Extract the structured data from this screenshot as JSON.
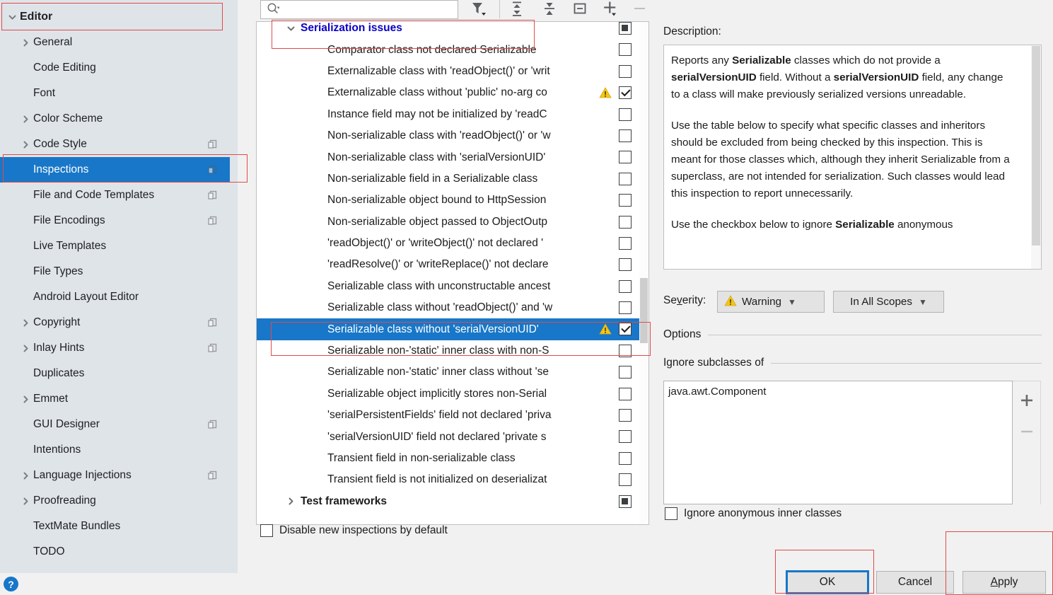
{
  "sidebar": {
    "root": {
      "label": "Editor",
      "expanded": true
    },
    "items": [
      {
        "label": "General",
        "arrow": "collapsed",
        "badge": false
      },
      {
        "label": "Code Editing",
        "arrow": "none",
        "badge": false
      },
      {
        "label": "Font",
        "arrow": "none",
        "badge": false
      },
      {
        "label": "Color Scheme",
        "arrow": "collapsed",
        "badge": false
      },
      {
        "label": "Code Style",
        "arrow": "collapsed",
        "badge": true
      },
      {
        "label": "Inspections",
        "arrow": "none",
        "badge": true,
        "selected": true
      },
      {
        "label": "File and Code Templates",
        "arrow": "none",
        "badge": true
      },
      {
        "label": "File Encodings",
        "arrow": "none",
        "badge": true
      },
      {
        "label": "Live Templates",
        "arrow": "none",
        "badge": false
      },
      {
        "label": "File Types",
        "arrow": "none",
        "badge": false
      },
      {
        "label": "Android Layout Editor",
        "arrow": "none",
        "badge": false
      },
      {
        "label": "Copyright",
        "arrow": "collapsed",
        "badge": true
      },
      {
        "label": "Inlay Hints",
        "arrow": "collapsed",
        "badge": true
      },
      {
        "label": "Duplicates",
        "arrow": "none",
        "badge": false
      },
      {
        "label": "Emmet",
        "arrow": "collapsed",
        "badge": false
      },
      {
        "label": "GUI Designer",
        "arrow": "none",
        "badge": true
      },
      {
        "label": "Intentions",
        "arrow": "none",
        "badge": false
      },
      {
        "label": "Language Injections",
        "arrow": "collapsed",
        "badge": true
      },
      {
        "label": "Proofreading",
        "arrow": "collapsed",
        "badge": false
      },
      {
        "label": "TextMate Bundles",
        "arrow": "none",
        "badge": false
      },
      {
        "label": "TODO",
        "arrow": "none",
        "badge": false
      }
    ],
    "help_label": "?"
  },
  "toolbar": {
    "search_value": "",
    "search_placeholder": "",
    "buttons": [
      {
        "name": "filter-icon",
        "tooltip": "Filter"
      },
      {
        "name": "expand-all-icon",
        "tooltip": "Expand All"
      },
      {
        "name": "collapse-all-icon",
        "tooltip": "Collapse All"
      },
      {
        "name": "reset-icon",
        "tooltip": "Reset To Default"
      },
      {
        "name": "add-icon",
        "tooltip": "Add"
      },
      {
        "name": "remove-icon",
        "tooltip": "Remove"
      }
    ]
  },
  "tree": {
    "rows": [
      {
        "label": "Serialization issues",
        "kind": "group",
        "check": "partial",
        "warn": false,
        "selected": false
      },
      {
        "label": "Comparator class not declared Serializable",
        "kind": "leaf",
        "check": "off",
        "warn": false,
        "selected": false
      },
      {
        "label": "Externalizable class with 'readObject()' or 'writ",
        "kind": "leaf",
        "check": "off",
        "warn": false,
        "selected": false
      },
      {
        "label": "Externalizable class without 'public' no-arg co",
        "kind": "leaf",
        "check": "on",
        "warn": true,
        "selected": false
      },
      {
        "label": "Instance field may not be initialized by 'readC",
        "kind": "leaf",
        "check": "off",
        "warn": false,
        "selected": false
      },
      {
        "label": "Non-serializable class with 'readObject()' or 'w",
        "kind": "leaf",
        "check": "off",
        "warn": false,
        "selected": false
      },
      {
        "label": "Non-serializable class with 'serialVersionUID'",
        "kind": "leaf",
        "check": "off",
        "warn": false,
        "selected": false
      },
      {
        "label": "Non-serializable field in a Serializable class",
        "kind": "leaf",
        "check": "off",
        "warn": false,
        "selected": false
      },
      {
        "label": "Non-serializable object bound to HttpSession",
        "kind": "leaf",
        "check": "off",
        "warn": false,
        "selected": false
      },
      {
        "label": "Non-serializable object passed to ObjectOutp",
        "kind": "leaf",
        "check": "off",
        "warn": false,
        "selected": false
      },
      {
        "label": "'readObject()' or 'writeObject()' not declared '",
        "kind": "leaf",
        "check": "off",
        "warn": false,
        "selected": false
      },
      {
        "label": "'readResolve()' or 'writeReplace()' not declare",
        "kind": "leaf",
        "check": "off",
        "warn": false,
        "selected": false
      },
      {
        "label": "Serializable class with unconstructable ancest",
        "kind": "leaf",
        "check": "off",
        "warn": false,
        "selected": false
      },
      {
        "label": "Serializable class without 'readObject()' and 'w",
        "kind": "leaf",
        "check": "off",
        "warn": false,
        "selected": false
      },
      {
        "label": "Serializable class without 'serialVersionUID'",
        "kind": "leaf",
        "check": "on",
        "warn": true,
        "selected": true
      },
      {
        "label": "Serializable non-'static' inner class with non-S",
        "kind": "leaf",
        "check": "off",
        "warn": false,
        "selected": false
      },
      {
        "label": "Serializable non-'static' inner class without 'se",
        "kind": "leaf",
        "check": "off",
        "warn": false,
        "selected": false
      },
      {
        "label": "Serializable object implicitly stores non-Serial",
        "kind": "leaf",
        "check": "off",
        "warn": false,
        "selected": false
      },
      {
        "label": "'serialPersistentFields' field not declared 'priva",
        "kind": "leaf",
        "check": "off",
        "warn": false,
        "selected": false
      },
      {
        "label": "'serialVersionUID' field not declared 'private s",
        "kind": "leaf",
        "check": "off",
        "warn": false,
        "selected": false
      },
      {
        "label": "Transient field in non-serializable class",
        "kind": "leaf",
        "check": "off",
        "warn": false,
        "selected": false
      },
      {
        "label": "Transient field is not initialized on deserializat",
        "kind": "leaf",
        "check": "off",
        "warn": false,
        "selected": false
      },
      {
        "label": "Test frameworks",
        "kind": "group-dim",
        "check": "partial",
        "warn": false,
        "selected": false
      }
    ]
  },
  "footer": {
    "disable_new_label": "Disable new inspections by default",
    "disable_new_checked": false
  },
  "description": {
    "title": "Description:",
    "paragraphs": [
      "Reports any <b>Serializable</b> classes which do not provide a <b>serialVersionUID</b> field. Without a <b>serialVersionUID</b> field, any change to a class will make previously serialized versions unreadable.",
      "Use the table below to specify what specific classes and inheritors should be excluded from being checked by this inspection. This is meant for those classes which, although they inherit Serializable from a superclass, are not intended for serialization. Such classes would lead this inspection to report unnecessarily.",
      "Use the checkbox below to ignore <b>Serializable</b> anonymous"
    ]
  },
  "severity": {
    "label": "Se<u>v</u>erity:",
    "value": "Warning",
    "scope_value": "In All Scopes"
  },
  "options": {
    "section_label": "Options",
    "ignore_subclasses_label": "Ignore subclasses of",
    "ignore_entries": [
      "java.awt.Component"
    ],
    "add_button": "+",
    "remove_button": "–",
    "anon_label": "Ignore anonymous inner classes",
    "anon_checked": false
  },
  "dialog_buttons": {
    "ok": "OK",
    "cancel": "Cancel",
    "apply_prefix": "A",
    "apply_rest": "pply"
  },
  "colors": {
    "selection_blue": "#1877c8",
    "group_text_blue": "#0a00c8",
    "annotation_red": "#e04b4b",
    "warning_yellow": "#f5c518",
    "sidebar_bg": "#dfe4e9",
    "panel_bg": "#f1f1f1"
  }
}
